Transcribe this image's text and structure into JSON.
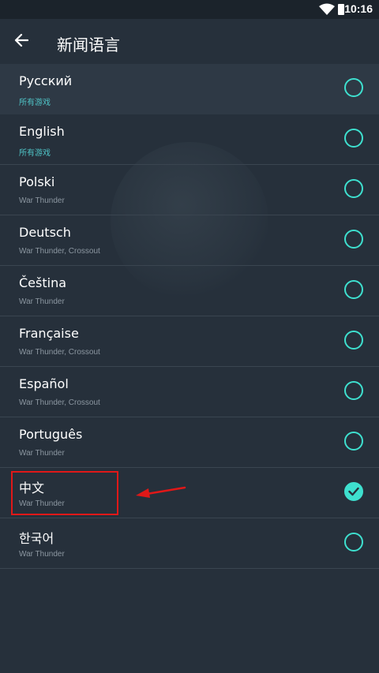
{
  "status_bar": {
    "time": "10:16",
    "icons": [
      "wifi-icon",
      "battery-icon"
    ]
  },
  "app_bar": {
    "title": "新闻语言",
    "back_icon": "arrow-back-icon"
  },
  "colors": {
    "accent": "#3ee0cf",
    "sub_accent": "#4fc3c6",
    "background": "#26303b",
    "annotation_red": "#e01818"
  },
  "languages": [
    {
      "name": "Русский",
      "games": "所有游戏",
      "selected": false
    },
    {
      "name": "English",
      "games": "所有游戏",
      "selected": false
    },
    {
      "name": "Polski",
      "games": "War Thunder",
      "selected": false
    },
    {
      "name": "Deutsch",
      "games": "War Thunder, Crossout",
      "selected": false
    },
    {
      "name": "Čeština",
      "games": "War Thunder",
      "selected": false
    },
    {
      "name": "Française",
      "games": "War Thunder, Crossout",
      "selected": false
    },
    {
      "name": "Español",
      "games": "War Thunder, Crossout",
      "selected": false
    },
    {
      "name": "Português",
      "games": "War Thunder",
      "selected": false
    },
    {
      "name": "中文",
      "games": "War Thunder",
      "selected": true
    },
    {
      "name": "한국어",
      "games": "War Thunder",
      "selected": false
    }
  ]
}
